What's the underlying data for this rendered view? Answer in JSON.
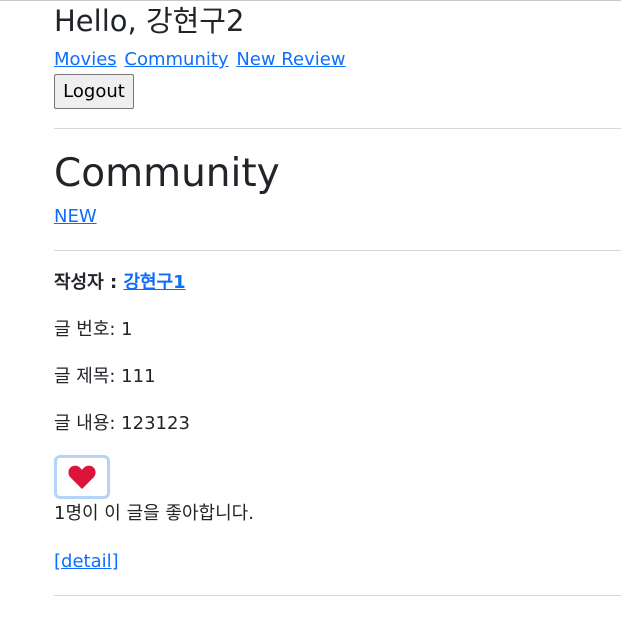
{
  "header": {
    "greeting": "Hello, 강현구2",
    "nav": [
      "Movies",
      "Community",
      "New Review"
    ],
    "logout_label": "Logout"
  },
  "page": {
    "title": "Community",
    "new_link": "NEW"
  },
  "post": {
    "author_label": "작성자 :",
    "author_name": "강현구1",
    "number_label": "글 번호: 1",
    "title_label": "글 제목: 111",
    "content_label": "글 내용: 123123",
    "like_icon": "heart-icon",
    "like_color": "#dc143c",
    "like_count_text": "1명이 이 글을 좋아합니다.",
    "detail_link": "[detail]"
  }
}
